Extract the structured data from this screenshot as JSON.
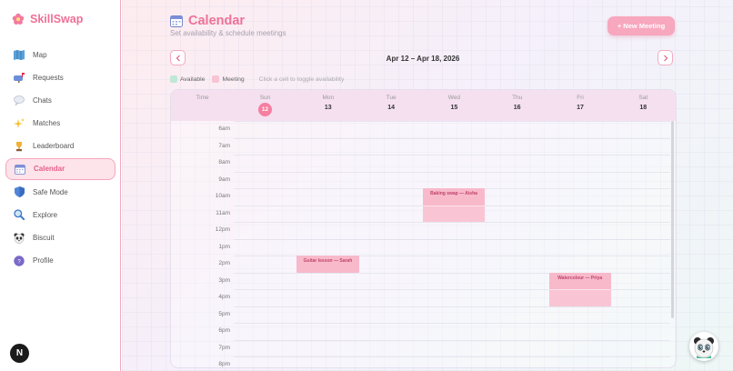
{
  "app": {
    "name": "SkillSwap"
  },
  "sidebar": {
    "items": [
      {
        "label": "Map",
        "icon": "map-icon"
      },
      {
        "label": "Requests",
        "icon": "mailbox-icon"
      },
      {
        "label": "Chats",
        "icon": "speech-bubble-icon"
      },
      {
        "label": "Matches",
        "icon": "sparkles-icon"
      },
      {
        "label": "Leaderboard",
        "icon": "trophy-icon"
      },
      {
        "label": "Calendar",
        "icon": "calendar-icon",
        "active": true
      },
      {
        "label": "Safe Mode",
        "icon": "shield-icon"
      },
      {
        "label": "Explore",
        "icon": "magnifier-icon"
      },
      {
        "label": "Biscuit",
        "icon": "panda-icon"
      },
      {
        "label": "Profile",
        "icon": "profile-avatar-icon"
      }
    ],
    "badge": "N"
  },
  "header": {
    "title": "Calendar",
    "subtitle": "Set availability & schedule meetings",
    "new_button": "+ New Meeting"
  },
  "week": {
    "range": "Apr 12 – Apr 18, 2026"
  },
  "legend": {
    "available": "Available",
    "meeting": "Meeting",
    "hint": "Click a cell to toggle availability",
    "available_color": "#bfe8d6",
    "meeting_color": "#f8c4d4"
  },
  "grid": {
    "time_header": "Time",
    "days": [
      {
        "name": "Sun",
        "date": "12",
        "today": true
      },
      {
        "name": "Mon",
        "date": "13"
      },
      {
        "name": "Tue",
        "date": "14"
      },
      {
        "name": "Wed",
        "date": "15"
      },
      {
        "name": "Thu",
        "date": "16"
      },
      {
        "name": "Fri",
        "date": "17"
      },
      {
        "name": "Sat",
        "date": "18"
      }
    ],
    "hours": [
      "6am",
      "7am",
      "8am",
      "9am",
      "10am",
      "11am",
      "12pm",
      "1pm",
      "2pm",
      "3pm",
      "4pm",
      "5pm",
      "6pm",
      "7pm",
      "8pm"
    ]
  },
  "events": [
    {
      "title": "Baking swap — Aisha",
      "day": "Wed",
      "start": "10am",
      "end": "12pm"
    },
    {
      "title": "Guitar lesson — Sarah",
      "day": "Mon",
      "start": "2pm",
      "end": "3pm"
    },
    {
      "title": "Watercolour — Priya",
      "day": "Fri",
      "start": "3pm",
      "end": "5pm"
    }
  ],
  "colors": {
    "accent": "#ef7199",
    "sidebar_border": "#f3a9bf",
    "today": "#f57fa0"
  }
}
